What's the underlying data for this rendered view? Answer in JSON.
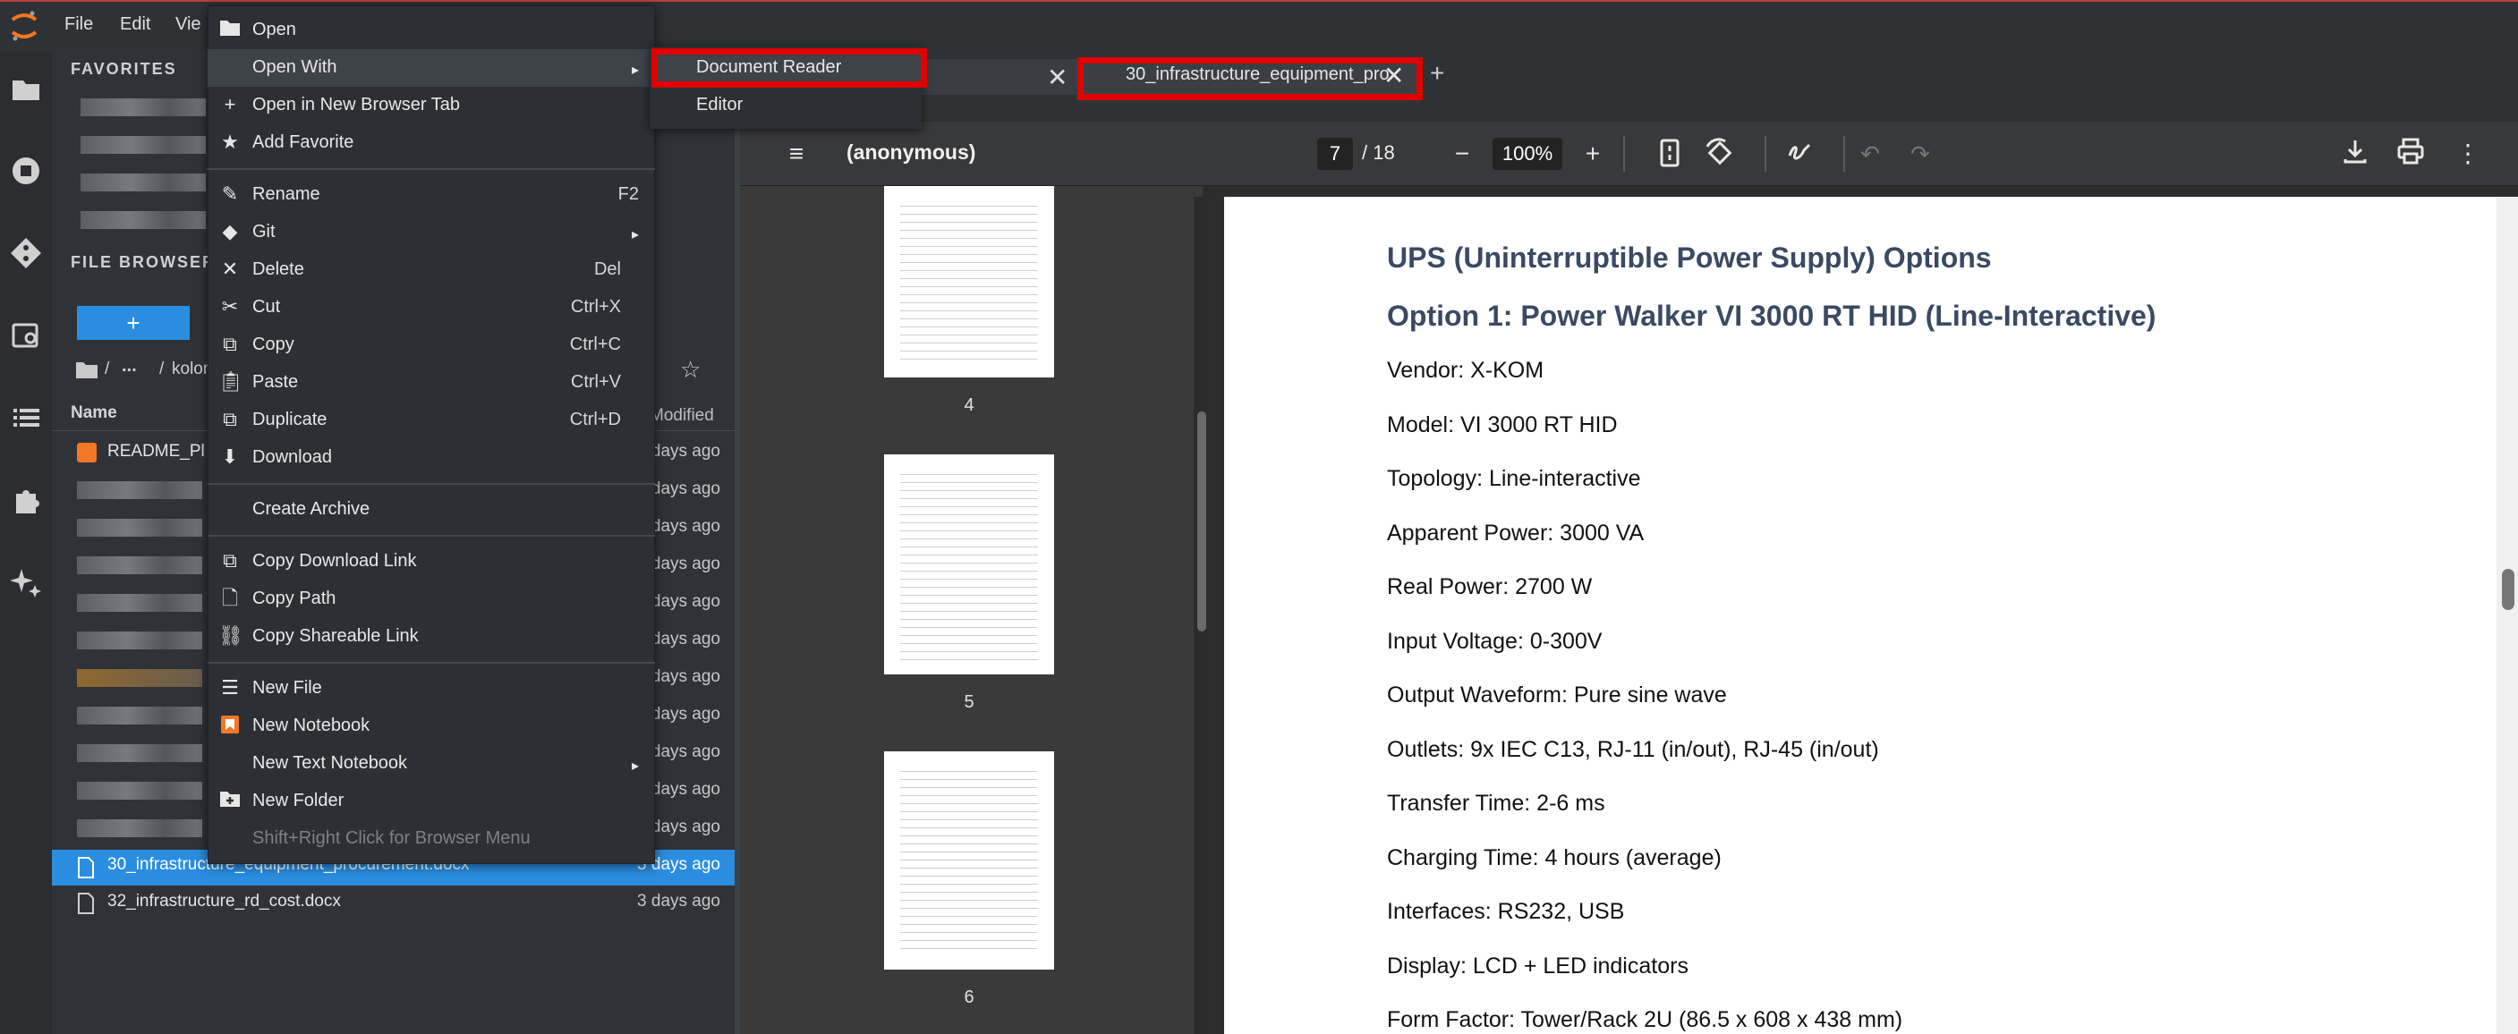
{
  "menubar": {
    "file": "File",
    "edit": "Edit",
    "view": "Vie"
  },
  "filebrowser": {
    "favorites_title": "FAVORITES",
    "title": "FILE BROWSER",
    "new_button": "+",
    "breadcrumb": {
      "root": "/",
      "ellipsis": "...",
      "sep": "/",
      "current": "kolon"
    },
    "columns": {
      "name": "Name",
      "modified": "Modified"
    },
    "rows": [
      {
        "name": "README_Pl",
        "modified": "days ago"
      },
      {
        "name": "",
        "modified": "days ago"
      },
      {
        "name": "",
        "modified": "days ago"
      },
      {
        "name": "",
        "modified": "days ago"
      },
      {
        "name": "",
        "modified": "days ago"
      },
      {
        "name": "",
        "modified": "days ago"
      },
      {
        "name": "",
        "modified": "days ago"
      },
      {
        "name": "",
        "modified": "days ago"
      },
      {
        "name": "",
        "modified": "days ago"
      },
      {
        "name": "",
        "modified": "days ago"
      },
      {
        "name": "",
        "modified": "days ago"
      }
    ],
    "selected_file": {
      "name": "30_infrastructure_equipment_procurement.docx",
      "modified": "3 days ago"
    },
    "next_file": {
      "name": "32_infrastructure_rd_cost.docx",
      "modified": "3 days ago"
    }
  },
  "tabs": {
    "active": "30_infrastructure_equipment_pro",
    "add": "+"
  },
  "pdf": {
    "doc_title": "(anonymous)",
    "page_current": "7",
    "page_total": "/ 18",
    "zoom": "100%",
    "thumb_numbers": [
      "4",
      "5",
      "6"
    ]
  },
  "document": {
    "heading1": "UPS (Uninterruptible Power Supply) Options",
    "heading2": "Option 1: Power Walker VI 3000 RT HID (Line-Interactive)",
    "lines": [
      "Vendor: X-KOM",
      "Model: VI 3000 RT HID",
      "Topology: Line-interactive",
      "Apparent Power: 3000 VA",
      "Real Power: 2700 W",
      "Input Voltage: 0-300V",
      "Output Waveform: Pure sine wave",
      "Outlets: 9x IEC C13, RJ-11 (in/out), RJ-45 (in/out)",
      "Transfer Time: 2-6 ms",
      "Charging Time: 4 hours (average)",
      "Interfaces: RS232, USB",
      "Display: LCD + LED indicators",
      "Form Factor: Tower/Rack 2U (86.5 x 608 x 438 mm)"
    ]
  },
  "context_menu": {
    "open": "Open",
    "open_with": "Open With",
    "open_new_tab": "Open in New Browser Tab",
    "add_favorite": "Add Favorite",
    "rename": "Rename",
    "rename_sc": "F2",
    "git": "Git",
    "delete": "Delete",
    "delete_sc": "Del",
    "cut": "Cut",
    "cut_sc": "Ctrl+X",
    "copy": "Copy",
    "copy_sc": "Ctrl+C",
    "paste": "Paste",
    "paste_sc": "Ctrl+V",
    "duplicate": "Duplicate",
    "duplicate_sc": "Ctrl+D",
    "download": "Download",
    "create_archive": "Create Archive",
    "copy_download_link": "Copy Download Link",
    "copy_path": "Copy Path",
    "copy_shareable_link": "Copy Shareable Link",
    "new_file": "New File",
    "new_notebook": "New Notebook",
    "new_text_notebook": "New Text Notebook",
    "new_folder": "New Folder",
    "shift_hint": "Shift+Right Click for Browser Menu"
  },
  "submenu": {
    "document_reader": "Document Reader",
    "editor": "Editor"
  }
}
